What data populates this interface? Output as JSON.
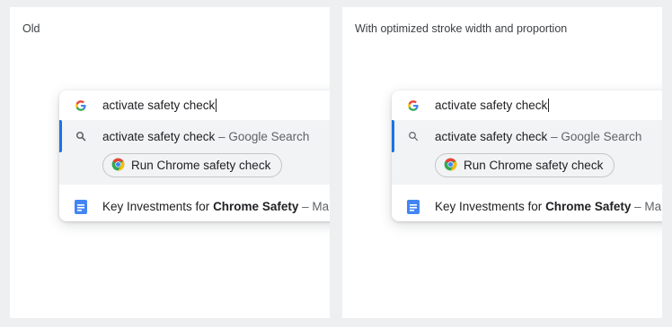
{
  "panels": [
    {
      "label": "Old",
      "omnibox": {
        "input_text": "activate safety check",
        "suggestion": {
          "query": "activate safety check",
          "source": "– Google Search"
        },
        "action_chip": {
          "label": "Run Chrome safety check"
        },
        "document": {
          "prefix": "Key Investments for ",
          "bold": "Chrome Safety",
          "suffix": " – Ma"
        }
      }
    },
    {
      "label": "With optimized stroke width and proportion",
      "omnibox": {
        "input_text": "activate safety check",
        "suggestion": {
          "query": "activate safety check",
          "source": "– Google Search"
        },
        "action_chip": {
          "label": "Run Chrome safety check"
        },
        "document": {
          "prefix": "Key Investments for ",
          "bold": "Chrome Safety",
          "suffix": " – Ma"
        }
      }
    }
  ],
  "colors": {
    "accent": "#1a73e8",
    "docs_blue": "#4285f4",
    "google_blue": "#4285f4",
    "google_red": "#ea4335",
    "google_yellow": "#fbbc05",
    "google_green": "#34a853"
  },
  "icons": [
    "google-g-icon",
    "search-icon",
    "chrome-icon",
    "google-docs-icon"
  ]
}
